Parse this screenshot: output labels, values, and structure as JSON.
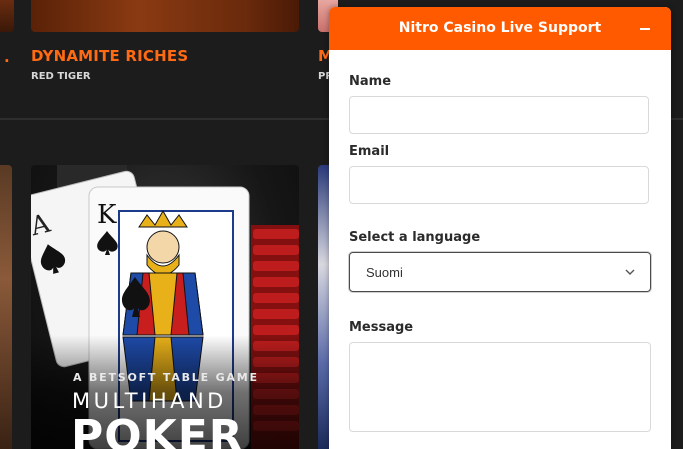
{
  "games_row1": [
    {
      "title": "DYNAMITE RICHES",
      "provider": "RED TIGER"
    },
    {
      "title": "M",
      "provider": "PR"
    }
  ],
  "partial_left_label": ".",
  "featured_game": {
    "subtitle": "A BETSOFT TABLE GAME",
    "title_line1": "MULTIHAND",
    "title_line2": "POKER"
  },
  "chat": {
    "title": "Nitro Casino Live Support",
    "name_label": "Name",
    "name_value": "",
    "email_label": "Email",
    "email_value": "",
    "language_label": "Select a language",
    "language_value": "Suomi",
    "message_label": "Message",
    "message_value": ""
  },
  "colors": {
    "accent": "#ff5a00",
    "game_title": "#ff6a13"
  },
  "icons": {
    "minimize": "minimize-icon",
    "dropdown": "chevron-down-icon"
  }
}
